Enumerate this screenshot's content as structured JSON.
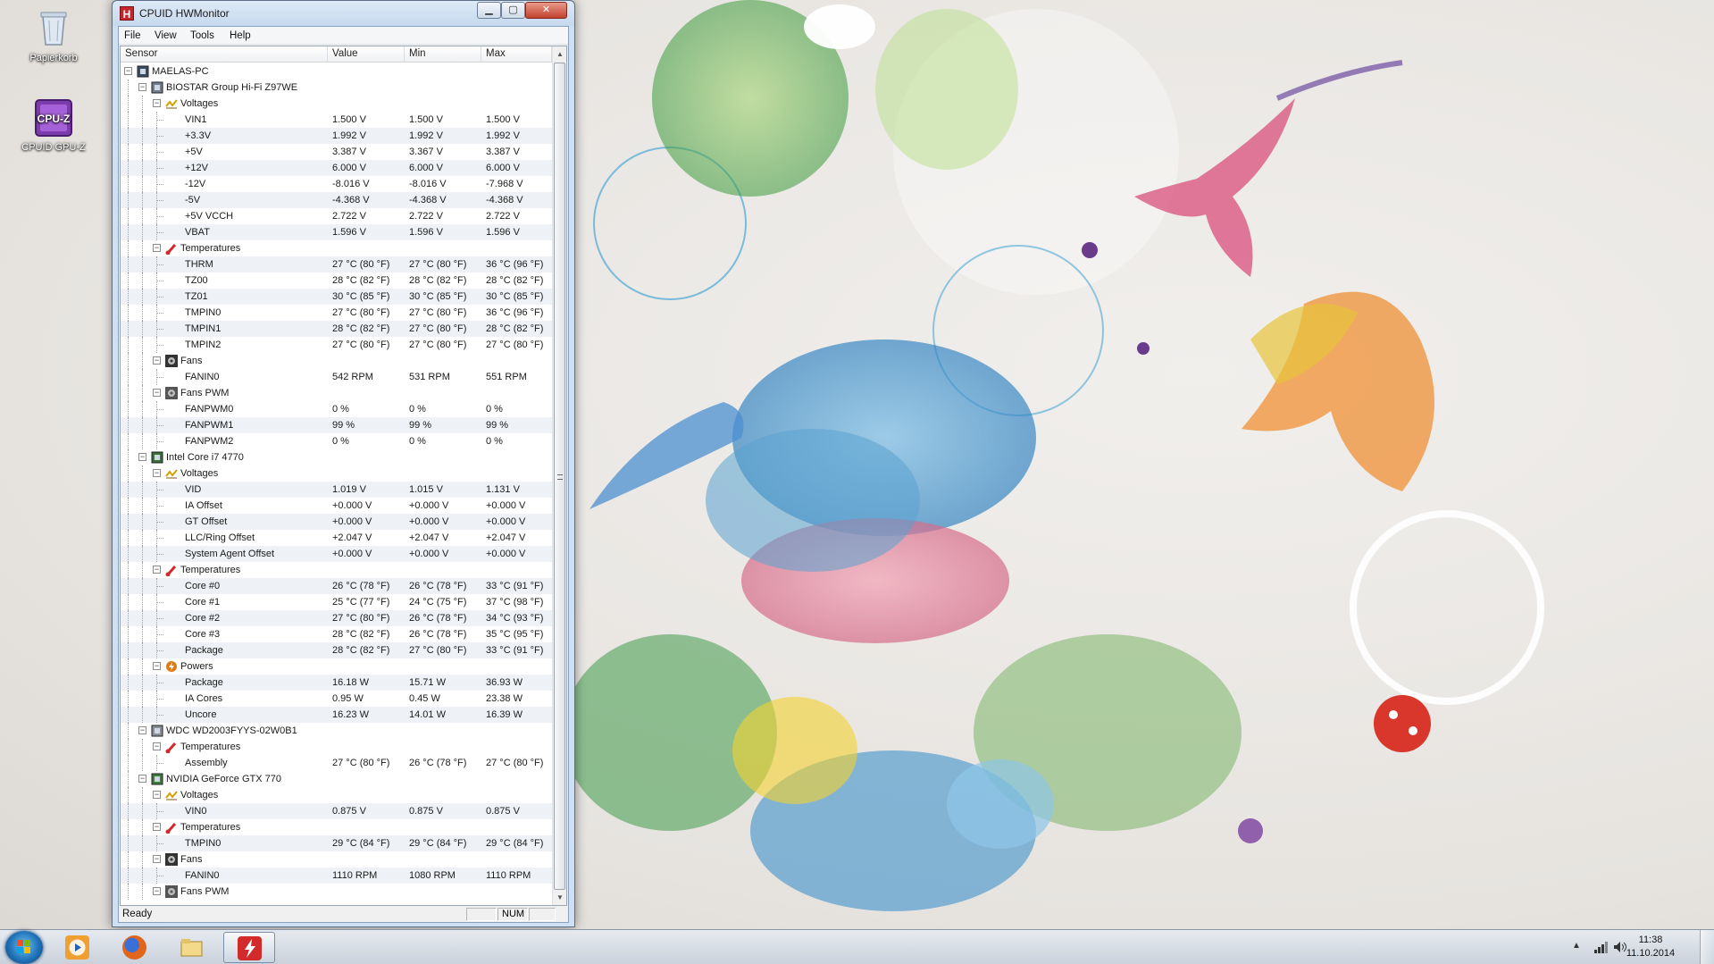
{
  "desktop": {
    "icons": [
      {
        "label": "Papierkorb",
        "icon": "recycle-bin-icon"
      },
      {
        "label": "CPUID GPU-Z",
        "icon": "gpuz-icon"
      }
    ]
  },
  "window": {
    "title": "CPUID HWMonitor",
    "buttons": {
      "minimize": "▁",
      "maximize": "▢",
      "close": "✕"
    }
  },
  "menu": [
    "File",
    "View",
    "Tools",
    "Help"
  ],
  "columns": [
    "Sensor",
    "Value",
    "Min",
    "Max"
  ],
  "tree": [
    {
      "level": 0,
      "type": "computer",
      "label": "MAELAS-PC",
      "icon": "computer-icon"
    },
    {
      "level": 1,
      "type": "device",
      "label": "BIOSTAR Group Hi-Fi Z97WE",
      "icon": "motherboard-icon"
    },
    {
      "level": 2,
      "type": "group",
      "label": "Voltages",
      "icon": "voltage-icon"
    },
    {
      "level": 3,
      "label": "VIN1",
      "value": "1.500 V",
      "min": "1.500 V",
      "max": "1.500 V"
    },
    {
      "level": 3,
      "label": "+3.3V",
      "value": "1.992 V",
      "min": "1.992 V",
      "max": "1.992 V"
    },
    {
      "level": 3,
      "label": "+5V",
      "value": "3.387 V",
      "min": "3.367 V",
      "max": "3.387 V"
    },
    {
      "level": 3,
      "label": "+12V",
      "value": "6.000 V",
      "min": "6.000 V",
      "max": "6.000 V"
    },
    {
      "level": 3,
      "label": "-12V",
      "value": "-8.016 V",
      "min": "-8.016 V",
      "max": "-7.968 V"
    },
    {
      "level": 3,
      "label": "-5V",
      "value": "-4.368 V",
      "min": "-4.368 V",
      "max": "-4.368 V"
    },
    {
      "level": 3,
      "label": "+5V VCCH",
      "value": "2.722 V",
      "min": "2.722 V",
      "max": "2.722 V"
    },
    {
      "level": 3,
      "label": "VBAT",
      "value": "1.596 V",
      "min": "1.596 V",
      "max": "1.596 V"
    },
    {
      "level": 2,
      "type": "group",
      "label": "Temperatures",
      "icon": "temperature-icon"
    },
    {
      "level": 3,
      "label": "THRM",
      "value": "27 °C (80 °F)",
      "min": "27 °C (80 °F)",
      "max": "36 °C (96 °F)"
    },
    {
      "level": 3,
      "label": "TZ00",
      "value": "28 °C (82 °F)",
      "min": "28 °C (82 °F)",
      "max": "28 °C (82 °F)"
    },
    {
      "level": 3,
      "label": "TZ01",
      "value": "30 °C (85 °F)",
      "min": "30 °C (85 °F)",
      "max": "30 °C (85 °F)"
    },
    {
      "level": 3,
      "label": "TMPIN0",
      "value": "27 °C (80 °F)",
      "min": "27 °C (80 °F)",
      "max": "36 °C (96 °F)"
    },
    {
      "level": 3,
      "label": "TMPIN1",
      "value": "28 °C (82 °F)",
      "min": "27 °C (80 °F)",
      "max": "28 °C (82 °F)"
    },
    {
      "level": 3,
      "label": "TMPIN2",
      "value": "27 °C (80 °F)",
      "min": "27 °C (80 °F)",
      "max": "27 °C (80 °F)"
    },
    {
      "level": 2,
      "type": "group",
      "label": "Fans",
      "icon": "fan-icon"
    },
    {
      "level": 3,
      "label": "FANIN0",
      "value": "542 RPM",
      "min": "531 RPM",
      "max": "551 RPM"
    },
    {
      "level": 2,
      "type": "group",
      "label": "Fans PWM",
      "icon": "fan-pwm-icon"
    },
    {
      "level": 3,
      "label": "FANPWM0",
      "value": "0 %",
      "min": "0 %",
      "max": "0 %"
    },
    {
      "level": 3,
      "label": "FANPWM1",
      "value": "99 %",
      "min": "99 %",
      "max": "99 %"
    },
    {
      "level": 3,
      "label": "FANPWM2",
      "value": "0 %",
      "min": "0 %",
      "max": "0 %"
    },
    {
      "level": 1,
      "type": "device",
      "label": "Intel Core i7 4770",
      "icon": "cpu-icon"
    },
    {
      "level": 2,
      "type": "group",
      "label": "Voltages",
      "icon": "voltage-icon"
    },
    {
      "level": 3,
      "label": "VID",
      "value": "1.019 V",
      "min": "1.015 V",
      "max": "1.131 V"
    },
    {
      "level": 3,
      "label": "IA Offset",
      "value": "+0.000 V",
      "min": "+0.000 V",
      "max": "+0.000 V"
    },
    {
      "level": 3,
      "label": "GT Offset",
      "value": "+0.000 V",
      "min": "+0.000 V",
      "max": "+0.000 V"
    },
    {
      "level": 3,
      "label": "LLC/Ring Offset",
      "value": "+2.047 V",
      "min": "+2.047 V",
      "max": "+2.047 V"
    },
    {
      "level": 3,
      "label": "System Agent Offset",
      "value": "+0.000 V",
      "min": "+0.000 V",
      "max": "+0.000 V"
    },
    {
      "level": 2,
      "type": "group",
      "label": "Temperatures",
      "icon": "temperature-icon"
    },
    {
      "level": 3,
      "label": "Core #0",
      "value": "26 °C (78 °F)",
      "min": "26 °C (78 °F)",
      "max": "33 °C (91 °F)"
    },
    {
      "level": 3,
      "label": "Core #1",
      "value": "25 °C (77 °F)",
      "min": "24 °C (75 °F)",
      "max": "37 °C (98 °F)"
    },
    {
      "level": 3,
      "label": "Core #2",
      "value": "27 °C (80 °F)",
      "min": "26 °C (78 °F)",
      "max": "34 °C (93 °F)"
    },
    {
      "level": 3,
      "label": "Core #3",
      "value": "28 °C (82 °F)",
      "min": "26 °C (78 °F)",
      "max": "35 °C (95 °F)"
    },
    {
      "level": 3,
      "label": "Package",
      "value": "28 °C (82 °F)",
      "min": "27 °C (80 °F)",
      "max": "33 °C (91 °F)"
    },
    {
      "level": 2,
      "type": "group",
      "label": "Powers",
      "icon": "power-icon"
    },
    {
      "level": 3,
      "label": "Package",
      "value": "16.18 W",
      "min": "15.71 W",
      "max": "36.93 W"
    },
    {
      "level": 3,
      "label": "IA Cores",
      "value": "0.95 W",
      "min": "0.45 W",
      "max": "23.38 W"
    },
    {
      "level": 3,
      "label": "Uncore",
      "value": "16.23 W",
      "min": "14.01 W",
      "max": "16.39 W"
    },
    {
      "level": 1,
      "type": "device",
      "label": "WDC WD2003FYYS-02W0B1",
      "icon": "hard-drive-icon"
    },
    {
      "level": 2,
      "type": "group",
      "label": "Temperatures",
      "icon": "temperature-icon"
    },
    {
      "level": 3,
      "label": "Assembly",
      "value": "27 °C (80 °F)",
      "min": "26 °C (78 °F)",
      "max": "27 °C (80 °F)"
    },
    {
      "level": 1,
      "type": "device",
      "label": "NVIDIA GeForce GTX 770",
      "icon": "gpu-icon"
    },
    {
      "level": 2,
      "type": "group",
      "label": "Voltages",
      "icon": "voltage-icon"
    },
    {
      "level": 3,
      "label": "VIN0",
      "value": "0.875 V",
      "min": "0.875 V",
      "max": "0.875 V"
    },
    {
      "level": 2,
      "type": "group",
      "label": "Temperatures",
      "icon": "temperature-icon"
    },
    {
      "level": 3,
      "label": "TMPIN0",
      "value": "29 °C (84 °F)",
      "min": "29 °C (84 °F)",
      "max": "29 °C (84 °F)"
    },
    {
      "level": 2,
      "type": "group",
      "label": "Fans",
      "icon": "fan-icon"
    },
    {
      "level": 3,
      "label": "FANIN0",
      "value": "1110 RPM",
      "min": "1080 RPM",
      "max": "1110 RPM"
    },
    {
      "level": 2,
      "type": "group",
      "label": "Fans PWM",
      "icon": "fan-pwm-icon"
    }
  ],
  "status": {
    "text": "Ready",
    "num": "NUM"
  },
  "taskbar": {
    "pinned": [
      {
        "name": "media-player",
        "icon": "media-player-icon",
        "color": "#f0a030"
      },
      {
        "name": "firefox",
        "icon": "firefox-icon",
        "color": "#e0661b"
      },
      {
        "name": "explorer",
        "icon": "folder-icon",
        "color": "#e8c86a"
      },
      {
        "name": "hwmonitor",
        "icon": "hwmonitor-icon",
        "color": "#d22b2b",
        "active": true
      }
    ],
    "clock": {
      "time": "11:38",
      "date": "11.10.2014"
    }
  }
}
